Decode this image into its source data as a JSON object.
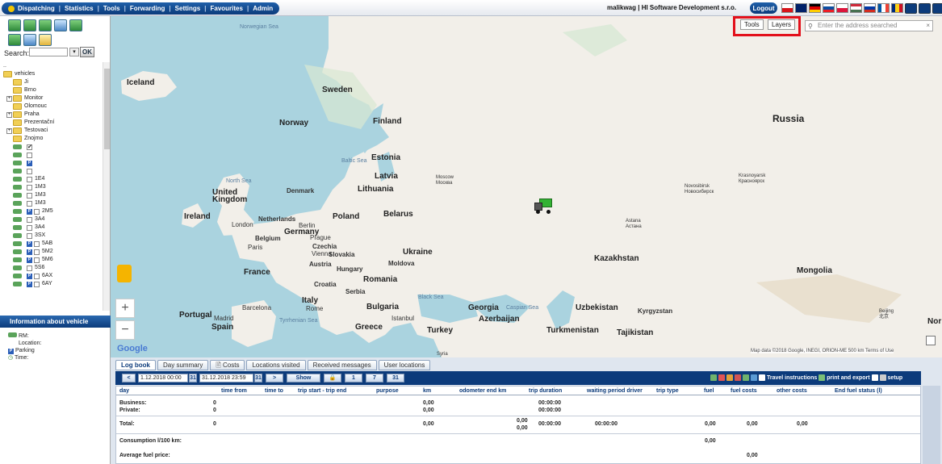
{
  "nav": {
    "items": [
      "Dispatching",
      "Statistics",
      "Tools",
      "Forwarding",
      "Settings",
      "Favourites",
      "Admin"
    ]
  },
  "header": {
    "user": "malikwag",
    "company": "HI Software Development s.r.o.",
    "logout_label": "Logout"
  },
  "left": {
    "search_label": "Search:",
    "ok_label": "OK",
    "tree_root": "..",
    "tree": [
      {
        "type": "folder",
        "label": "vehicles",
        "level": 0
      },
      {
        "type": "folder",
        "label": "Ji",
        "level": 1
      },
      {
        "type": "folder",
        "label": "Brno",
        "level": 1
      },
      {
        "type": "folder",
        "label": "Monitor",
        "level": 1,
        "expand": true
      },
      {
        "type": "folder",
        "label": "Olomouc",
        "level": 1
      },
      {
        "type": "folder",
        "label": "Praha",
        "level": 1,
        "expand": true
      },
      {
        "type": "folder",
        "label": "Prezentační",
        "level": 1
      },
      {
        "type": "folder",
        "label": "Testovaci",
        "level": 1,
        "expand": true
      },
      {
        "type": "folder",
        "label": "Znojmo",
        "level": 1
      },
      {
        "type": "vehicle",
        "label": "",
        "checked": true
      },
      {
        "type": "vehicle",
        "label": ""
      },
      {
        "type": "vehicle",
        "label": "",
        "badge": true,
        "nocheck": true
      },
      {
        "type": "vehicle",
        "label": ""
      },
      {
        "type": "vehicle",
        "label": "1E4"
      },
      {
        "type": "vehicle",
        "label": "1M3"
      },
      {
        "type": "vehicle",
        "label": "1M3"
      },
      {
        "type": "vehicle",
        "label": "1M3"
      },
      {
        "type": "vehicle",
        "label": "2M5",
        "badge": true
      },
      {
        "type": "vehicle",
        "label": "3A4"
      },
      {
        "type": "vehicle",
        "label": "3A4"
      },
      {
        "type": "vehicle",
        "label": "3SX"
      },
      {
        "type": "vehicle",
        "label": "5AB",
        "badge": true
      },
      {
        "type": "vehicle",
        "label": "5M2",
        "badge": true
      },
      {
        "type": "vehicle",
        "label": "5M6",
        "badge": true
      },
      {
        "type": "vehicle",
        "label": "5S6"
      },
      {
        "type": "vehicle",
        "label": "6AX",
        "badge": true
      },
      {
        "type": "vehicle",
        "label": "6AY",
        "badge": true
      }
    ],
    "info_title": "Information about vehicle",
    "info": {
      "rm": "RM:",
      "location": "Location:",
      "parking": "Parking",
      "time": "Time:"
    }
  },
  "map": {
    "tools_label": "Tools",
    "layers_label": "Layers",
    "address_placeholder": "Enter the address searched",
    "attribution": "Map data ©2018 Google, INEGI, ORION-ME   500 km",
    "terms": "Terms of Use",
    "google_logo": "Google",
    "labels": {
      "iceland": "Iceland",
      "norwegian_sea": "Norwegian Sea",
      "sweden": "Sweden",
      "norway": "Norway",
      "finland": "Finland",
      "russia": "Russia",
      "estonia": "Estonia",
      "latvia": "Latvia",
      "baltic_sea": "Baltic Sea",
      "lithuania": "Lithuania",
      "north_sea": "North Sea",
      "denmark": "Denmark",
      "united_kingdom": "United Kingdom",
      "ireland": "Ireland",
      "netherlands": "Netherlands",
      "london": "London",
      "berlin": "Berlin",
      "poland": "Poland",
      "belarus": "Belarus",
      "germany": "Germany",
      "belgium": "Belgium",
      "prague": "Prague",
      "czechia": "Czechia",
      "paris": "Paris",
      "vienna": "Vienna",
      "slovakia": "Slovakia",
      "ukraine": "Ukraine",
      "moldova": "Moldova",
      "austria": "Austria",
      "hungary": "Hungary",
      "france": "France",
      "romania": "Romania",
      "croatia": "Croatia",
      "serbia": "Serbia",
      "italy": "Italy",
      "bulgaria": "Bulgaria",
      "black_sea": "Black Sea",
      "portugal": "Portugal",
      "madrid": "Madrid",
      "spain": "Spain",
      "barcelona": "Barcelona",
      "rome": "Rome",
      "tyrrhenian_sea": "Tyrrhenian Sea",
      "greece": "Greece",
      "istanbul": "Istanbul",
      "turkey": "Turkey",
      "georgia": "Georgia",
      "azerbaijan": "Azerbaijan",
      "caspian_sea": "Caspian Sea",
      "kazakhstan": "Kazakhstan",
      "uzbekistan": "Uzbekistan",
      "turkmenistan": "Turkmenistan",
      "kyrgyzstan": "Kyrgyzstan",
      "tajikistan": "Tajikistan",
      "mongolia": "Mongolia",
      "moscow": "Moscow\nМосква",
      "novosibirsk": "Novosibirsk\nНовосибирск",
      "krasnoyarsk": "Krasnoyarsk\nКрасноярск",
      "astana": "Astana\nАстана",
      "beijing": "Beijing\n北京",
      "nor": "Nor",
      "syria": "Syria"
    }
  },
  "logbook": {
    "tabs": [
      "Log book",
      "Day summary",
      "Costs",
      "Locations visited",
      "Received messages",
      "User locations"
    ],
    "nav": {
      "prev": "<",
      "date_from": "1.12.2018 00:00",
      "date_to": "31.12.2018 23:59",
      "cal": "31",
      "next": ">",
      "show": "Show",
      "lock": "🔒",
      "d1": "1",
      "d7": "7",
      "d31": "31"
    },
    "links": {
      "travel": "Travel instructions",
      "print": "print and export",
      "setup": "setup"
    },
    "columns": [
      "day",
      "time from",
      "time to",
      "trip start - trip end",
      "purpose",
      "km",
      "odometer end km",
      "trip duration",
      "waiting period driver",
      "trip type",
      "fuel",
      "fuel costs",
      "other costs",
      "End fuel status (l)"
    ],
    "rows": {
      "business": {
        "label": "Business:",
        "time_from": "0",
        "km": "0,00",
        "duration": "00:00:00"
      },
      "private": {
        "label": "Private:",
        "time_from": "0",
        "km": "0,00",
        "duration": "00:00:00"
      },
      "total": {
        "label": "Total:",
        "time_from": "0",
        "km": "0,00",
        "odo1": "0,00",
        "odo2": "0,00",
        "duration": "00:00:00",
        "waiting": "00:00:00",
        "fuel": "0,00",
        "fuel_costs": "0,00",
        "other_costs": "0,00"
      },
      "consumption": {
        "label": "Consumption l/100 km:",
        "fuel": "0,00"
      },
      "avg_price": {
        "label": "Average fuel price:",
        "fuel_costs": "0,00"
      }
    }
  }
}
